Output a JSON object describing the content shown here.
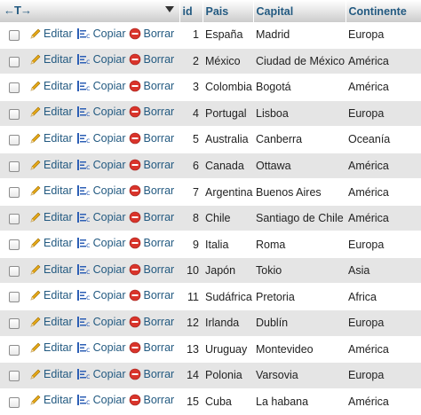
{
  "header": {
    "id": "id",
    "pais": "Pais",
    "capital": "Capital",
    "continente": "Continente",
    "arrows_glyph": "←T→"
  },
  "actions": {
    "edit": "Editar",
    "copy": "Copiar",
    "delete": "Borrar"
  },
  "rows": [
    {
      "id": "1",
      "pais": "España",
      "capital": "Madrid",
      "continente": "Europa"
    },
    {
      "id": "2",
      "pais": "México",
      "capital": "Ciudad de México",
      "continente": "América"
    },
    {
      "id": "3",
      "pais": "Colombia",
      "capital": "Bogotá",
      "continente": "América"
    },
    {
      "id": "4",
      "pais": "Portugal",
      "capital": "Lisboa",
      "continente": "Europa"
    },
    {
      "id": "5",
      "pais": "Australia",
      "capital": "Canberra",
      "continente": "Oceanía"
    },
    {
      "id": "6",
      "pais": "Canada",
      "capital": "Ottawa",
      "continente": "América"
    },
    {
      "id": "7",
      "pais": "Argentina",
      "capital": "Buenos Aires",
      "continente": "América"
    },
    {
      "id": "8",
      "pais": "Chile",
      "capital": "Santiago de  Chile",
      "continente": "América"
    },
    {
      "id": "9",
      "pais": "Italia",
      "capital": "Roma",
      "continente": "Europa"
    },
    {
      "id": "10",
      "pais": "Japón",
      "capital": "Tokio",
      "continente": "Asia"
    },
    {
      "id": "11",
      "pais": "Sudáfrica",
      "capital": "Pretoria",
      "continente": "Africa"
    },
    {
      "id": "12",
      "pais": "Irlanda",
      "capital": "Dublín",
      "continente": "Europa"
    },
    {
      "id": "13",
      "pais": "Uruguay",
      "capital": "Montevideo",
      "continente": "América"
    },
    {
      "id": "14",
      "pais": "Polonia",
      "capital": "Varsovia",
      "continente": "Europa"
    },
    {
      "id": "15",
      "pais": "Cuba",
      "capital": "La habana",
      "continente": "América"
    }
  ],
  "colors": {
    "link": "#235a81",
    "row_alt": "#e5e5e5",
    "delete_icon": "#d9342b",
    "edit_icon": "#e6a817"
  },
  "icons": {
    "edit": "pencil-icon",
    "copy": "copy-icon",
    "delete": "delete-icon",
    "sort": "sort-dropdown-icon",
    "arrows": "column-arrows-icon"
  }
}
